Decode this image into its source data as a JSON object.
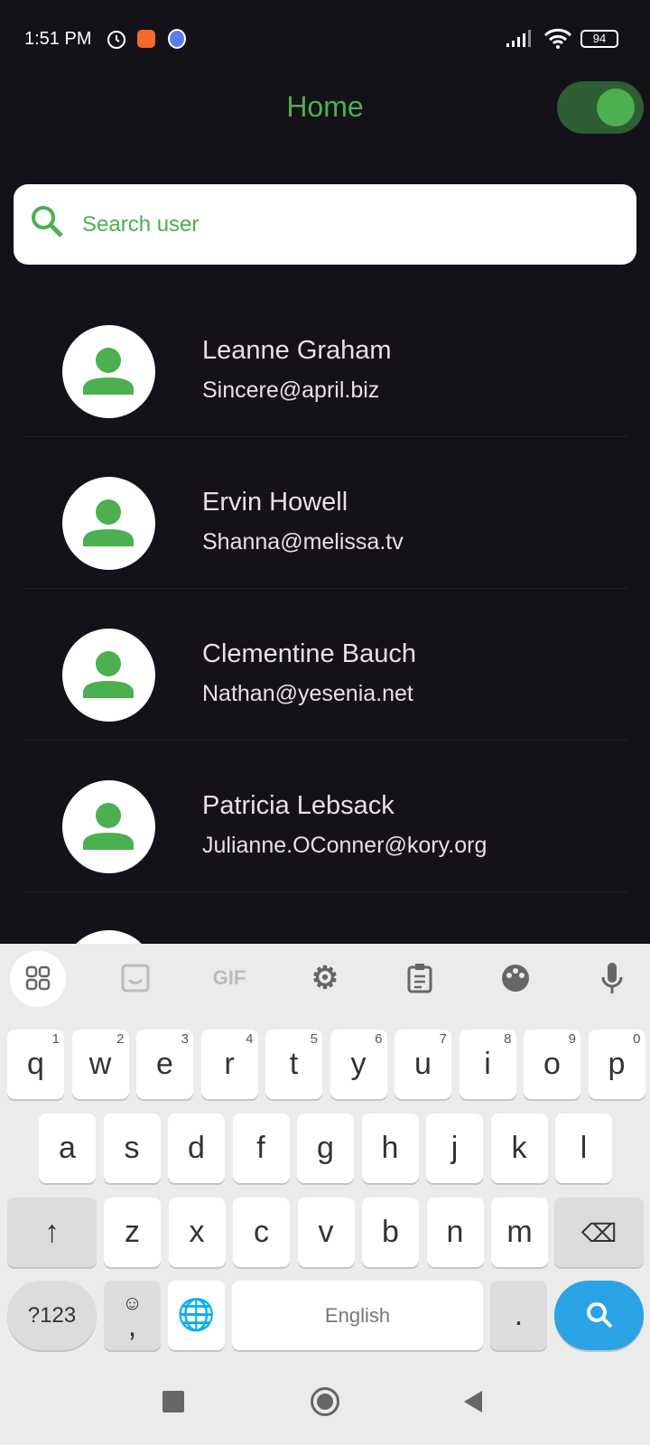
{
  "status_bar": {
    "time": "1:51 PM",
    "battery": "94"
  },
  "header": {
    "title": "Home",
    "theme_toggle_on": true
  },
  "search": {
    "placeholder": "Search user"
  },
  "users": [
    {
      "name": "Leanne Graham",
      "email": "Sincere@april.biz"
    },
    {
      "name": "Ervin Howell",
      "email": "Shanna@melissa.tv"
    },
    {
      "name": "Clementine Bauch",
      "email": "Nathan@yesenia.net"
    },
    {
      "name": "Patricia Lebsack",
      "email": "Julianne.OConner@kory.org"
    }
  ],
  "keyboard": {
    "toolbar": {
      "gif": "GIF"
    },
    "row1": [
      [
        "q",
        "1"
      ],
      [
        "w",
        "2"
      ],
      [
        "e",
        "3"
      ],
      [
        "r",
        "4"
      ],
      [
        "t",
        "5"
      ],
      [
        "y",
        "6"
      ],
      [
        "u",
        "7"
      ],
      [
        "i",
        "8"
      ],
      [
        "o",
        "9"
      ],
      [
        "p",
        "0"
      ]
    ],
    "row2": [
      "a",
      "s",
      "d",
      "f",
      "g",
      "h",
      "j",
      "k",
      "l"
    ],
    "row3": [
      "z",
      "x",
      "c",
      "v",
      "b",
      "n",
      "m"
    ],
    "symbols": "?123",
    "comma": ",",
    "space": "English",
    "period": "."
  },
  "colors": {
    "accent": "#4caf50",
    "background": "#141218",
    "search_key": "#2aa3e6"
  }
}
